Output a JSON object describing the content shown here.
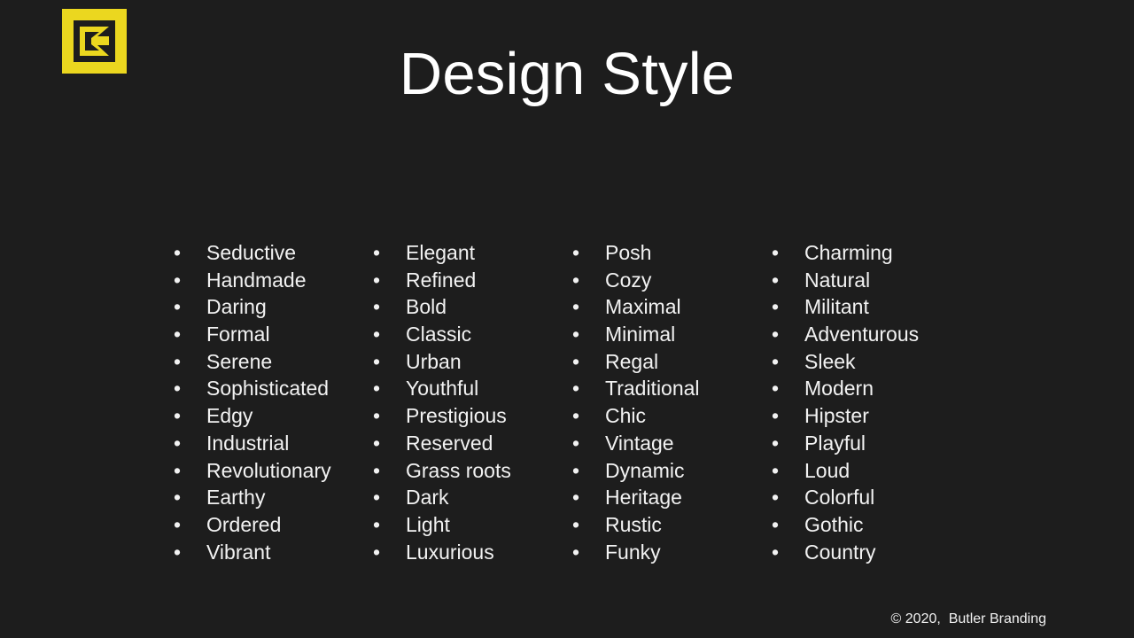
{
  "slide": {
    "title": "Design Style",
    "background_color": "#1d1d1d",
    "text_color": "#f2f2f2"
  },
  "logo": {
    "name": "butler-branding-logo",
    "square_color": "#ebd71f",
    "glyph_color": "#1d1d1d"
  },
  "bullet_char": "•",
  "columns": [
    {
      "name": "column-1",
      "items": [
        "Seductive",
        "Handmade",
        "Daring",
        "Formal",
        "Serene",
        "Sophisticated",
        "Edgy",
        "Industrial",
        "Revolutionary",
        "Earthy",
        "Ordered",
        "Vibrant"
      ]
    },
    {
      "name": "column-2",
      "items": [
        "Elegant",
        "Refined",
        "Bold",
        "Classic",
        "Urban",
        "Youthful",
        "Prestigious",
        "Reserved",
        "Grass roots",
        "Dark",
        "Light",
        "Luxurious"
      ]
    },
    {
      "name": "column-3",
      "items": [
        "Posh",
        "Cozy",
        "Maximal",
        "Minimal",
        "Regal",
        "Traditional",
        "Chic",
        "Vintage",
        "Dynamic",
        "Heritage",
        "Rustic",
        "Funky"
      ]
    },
    {
      "name": "column-4",
      "items": [
        "Charming",
        "Natural",
        "Militant",
        "Adventurous",
        "Sleek",
        "Modern",
        "Hipster",
        "Playful",
        "Loud",
        "Colorful",
        "Gothic",
        "Country"
      ]
    }
  ],
  "footer": {
    "copyright": "© 2020,  Butler Branding"
  }
}
